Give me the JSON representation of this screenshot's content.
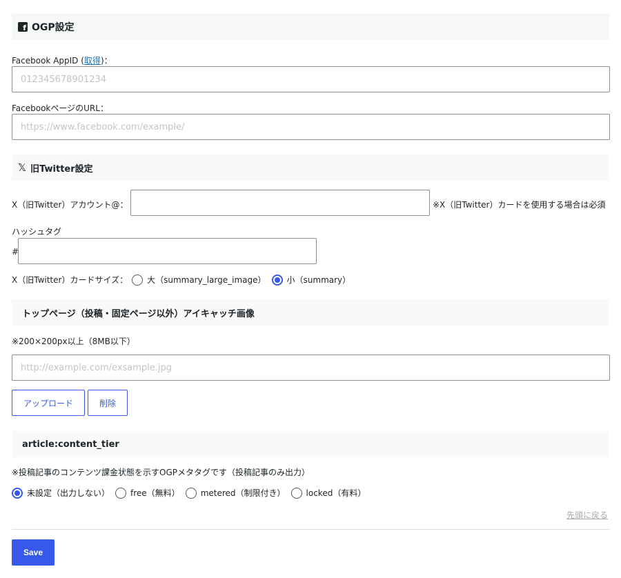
{
  "ogp": {
    "header": "OGP設定",
    "fb_appid_label": "Facebook AppID (",
    "fb_appid_link": "取得",
    "fb_appid_label_end": ")：",
    "fb_appid_placeholder": "012345678901234",
    "fb_page_label": "FacebookページのURL：",
    "fb_page_placeholder": "https://www.facebook.com/example/"
  },
  "twitter": {
    "header": "旧Twitter設定",
    "account_label": "X（旧Twitter）アカウント@：",
    "account_value": "",
    "account_note": "※X（旧Twitter）カードを使用する場合は必須",
    "hashtag_label": "ハッシュタグ",
    "hashtag_prefix": "#",
    "hashtag_value": "",
    "card_size_label": "X（旧Twitter）カードサイズ：",
    "card_size_options": [
      {
        "label": "大（summary_large_image）",
        "checked": false
      },
      {
        "label": "小（summary）",
        "checked": true
      }
    ]
  },
  "eyecatch": {
    "header": "トップページ（投稿・固定ページ以外）アイキャッチ画像",
    "note": "※200×200px以上（8MB以下）",
    "url_placeholder": "http://example.com/exsample.jpg",
    "upload_label": "アップロード",
    "delete_label": "削除"
  },
  "content_tier": {
    "header": "article:content_tier",
    "note": "※投稿記事のコンテンツ課金状態を示すOGPメタタグです（投稿記事のみ出力）",
    "options": [
      {
        "label": "未設定（出力しない）",
        "checked": true
      },
      {
        "label": "free（無料）",
        "checked": false
      },
      {
        "label": "metered（制限付き）",
        "checked": false
      },
      {
        "label": "locked（有料）",
        "checked": false
      }
    ]
  },
  "back_to_top": "先頭に戻る",
  "save_label": "Save",
  "colors": {
    "accent": "#3858e9",
    "link": "#2271b1"
  }
}
